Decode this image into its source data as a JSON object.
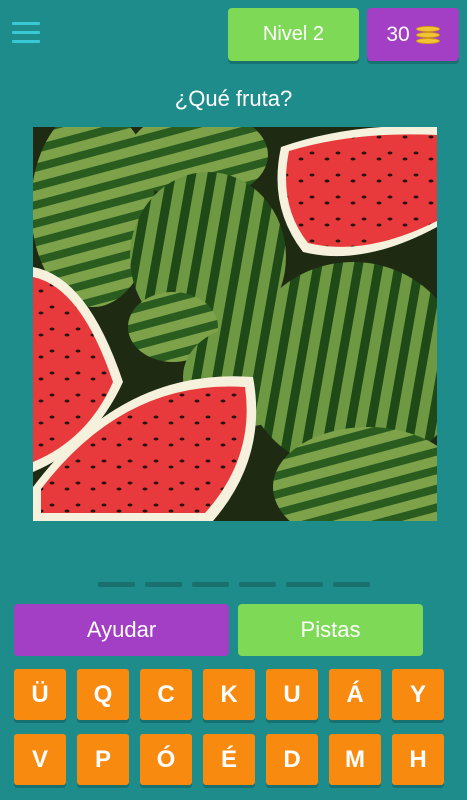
{
  "header": {
    "level_label": "Nivel 2",
    "coins": "30"
  },
  "question": "¿Qué fruta?",
  "image": {
    "subject": "watermelons"
  },
  "answer_slots": 6,
  "actions": {
    "help_label": "Ayudar",
    "hints_label": "Pistas"
  },
  "keyboard": {
    "row1": [
      "Ü",
      "Q",
      "C",
      "K",
      "U",
      "Á",
      "Y"
    ],
    "row2": [
      "V",
      "P",
      "Ó",
      "É",
      "D",
      "M",
      "H"
    ]
  },
  "colors": {
    "background": "#1f8c8c",
    "green_button": "#7ed957",
    "purple_button": "#a23fc4",
    "key_orange": "#f98a10"
  }
}
